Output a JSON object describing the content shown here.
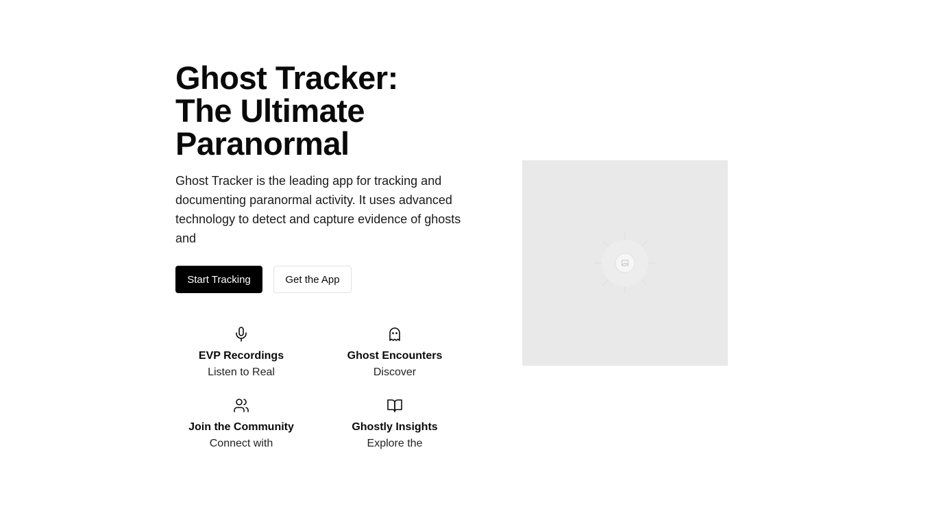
{
  "hero": {
    "title_lines": [
      "Ghost Tracker:",
      "The Ultimate",
      "Paranormal"
    ],
    "description": "Ghost Tracker is the leading app for tracking and documenting paranormal activity. It uses advanced technology to detect and capture evidence of ghosts and",
    "primary_button": "Start Tracking",
    "secondary_button": "Get the App"
  },
  "features": [
    {
      "icon": "microphone-icon",
      "title": "EVP Recordings",
      "description": "Listen to Real"
    },
    {
      "icon": "ghost-icon",
      "title": "Ghost Encounters",
      "description": "Discover"
    },
    {
      "icon": "users-icon",
      "title": "Join the Community",
      "description": "Connect with"
    },
    {
      "icon": "book-open-icon",
      "title": "Ghostly Insights",
      "description": "Explore the"
    }
  ],
  "image": {
    "icon": "image-placeholder-icon"
  },
  "colors": {
    "primary_button_bg": "#000000",
    "primary_button_text": "#ffffff",
    "placeholder_bg": "#e9e9e9"
  }
}
